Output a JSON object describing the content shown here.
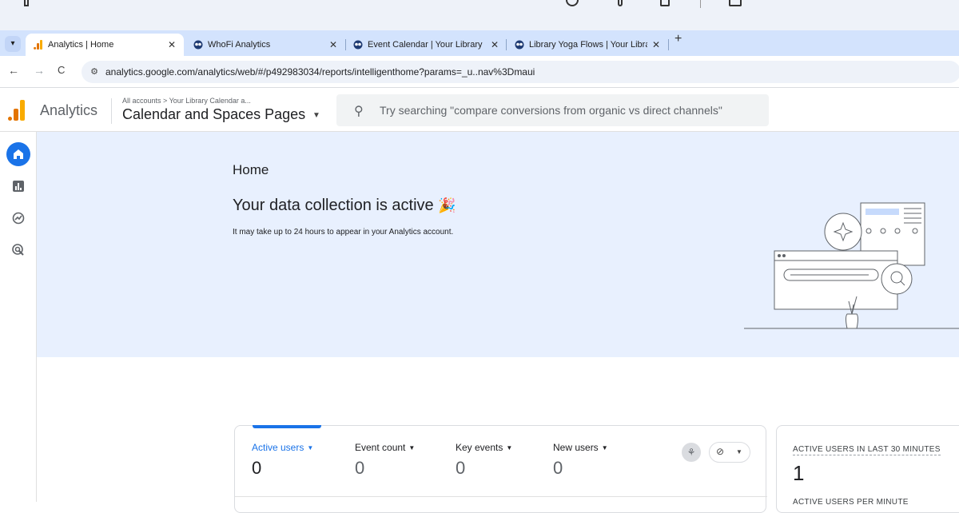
{
  "browser": {
    "tabs": [
      {
        "title": "Analytics | Home",
        "active": true
      },
      {
        "title": "WhoFi Analytics",
        "active": false
      },
      {
        "title": "Event Calendar | Your Library",
        "active": false
      },
      {
        "title": "Library Yoga Flows | Your Libra",
        "active": false
      }
    ],
    "close_glyph": "✕",
    "new_tab_glyph": "+",
    "url": "analytics.google.com/analytics/web/#/p492983034/reports/intelligenthome?params=_u..nav%3Dmaui"
  },
  "header": {
    "app_name": "Analytics",
    "breadcrumb": "All accounts > Your Library Calendar a...",
    "property_name": "Calendar and Spaces Pages",
    "search_placeholder": "Try searching \"compare conversions from organic vs direct channels\""
  },
  "rail": {
    "items": [
      "home-icon",
      "reports-icon",
      "explore-icon",
      "advertising-icon"
    ]
  },
  "hero": {
    "title": "Home",
    "subtitle": "Your data collection is active",
    "subtitle_emoji": "🎉",
    "note": "It may take up to 24 hours to appear in your Analytics account."
  },
  "metrics": [
    {
      "label": "Active users",
      "value": "0",
      "selected": true
    },
    {
      "label": "Event count",
      "value": "0",
      "selected": false
    },
    {
      "label": "Key events",
      "value": "0",
      "selected": false
    },
    {
      "label": "New users",
      "value": "0",
      "selected": false
    }
  ],
  "realtime": {
    "label": "ACTIVE USERS IN LAST 30 MINUTES",
    "value": "1",
    "sub_label": "ACTIVE USERS PER MINUTE"
  },
  "colors": {
    "accent": "#1a73e8",
    "hero_bg": "#e8f0fe",
    "tabbar_bg": "#d3e3fd"
  }
}
